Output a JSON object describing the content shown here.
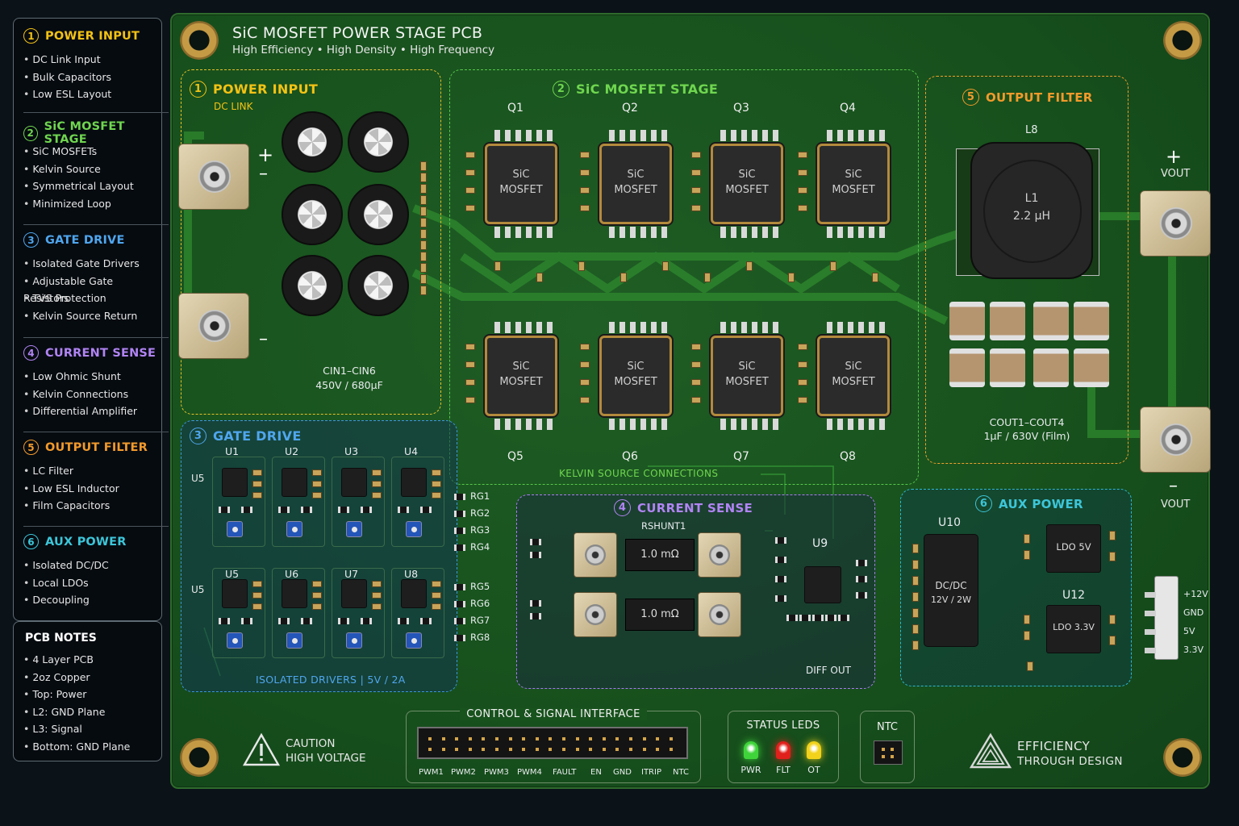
{
  "title": "SiC MOSFET POWER STAGE PCB",
  "subtitle": "High Efficiency • High Density • High Frequency",
  "colors": {
    "yellow": "#f3c214",
    "green": "#6fd64f",
    "blue": "#4fa6ee",
    "purple": "#b184f5",
    "orange": "#f39a2b",
    "cyan": "#3cc6d9",
    "board": "#1a5420"
  },
  "sidebar": [
    {
      "num": "1",
      "title": "POWER INPUT",
      "items": [
        "DC Link Input",
        "Bulk Capacitors",
        "Low ESL Layout"
      ]
    },
    {
      "num": "2",
      "title": "SiC MOSFET STAGE",
      "items": [
        "SiC MOSFETs",
        "Kelvin Source",
        "Symmetrical Layout",
        "Minimized Loop"
      ]
    },
    {
      "num": "3",
      "title": "GATE DRIVE",
      "items": [
        "Isolated Gate Drivers",
        "Adjustable Gate Resistors",
        "TVS Protection",
        "Kelvin Source Return"
      ]
    },
    {
      "num": "4",
      "title": "CURRENT SENSE",
      "items": [
        "Low Ohmic Shunt",
        "Kelvin Connections",
        "Differential Amplifier"
      ]
    },
    {
      "num": "5",
      "title": "OUTPUT FILTER",
      "items": [
        "LC Filter",
        "Low ESL Inductor",
        "Film Capacitors"
      ]
    },
    {
      "num": "6",
      "title": "AUX POWER",
      "items": [
        "Isolated DC/DC",
        "Local LDOs",
        "Decoupling"
      ]
    }
  ],
  "notes": {
    "title": "PCB NOTES",
    "items": [
      "4 Layer PCB",
      "2oz Copper",
      "Top: Power",
      "L2: GND Plane",
      "L3: Signal",
      "Bottom: GND Plane"
    ]
  },
  "zones": {
    "power_input": {
      "num": "1",
      "title": "POWER INPUT",
      "sub": "DC LINK",
      "cap_ref": "CIN1–CIN6",
      "cap_val": "450V / 680µF",
      "plus": "+",
      "minus": "–"
    },
    "mosfet": {
      "num": "2",
      "title": "SiC  MOSFET STAGE",
      "top_labels": [
        "Q1",
        "Q2",
        "Q3",
        "Q4"
      ],
      "bottom_labels": [
        "Q5",
        "Q6",
        "Q7",
        "Q8"
      ],
      "chip_line1": "SiC",
      "chip_line2": "MOSFET",
      "kelvin": "KELVIN SOURCE CONNECTIONS"
    },
    "output": {
      "num": "5",
      "title": "OUTPUT FILTER",
      "inductor_ref_top": "L8",
      "inductor_ref": "L1",
      "inductor_val": "2.2 µH",
      "cap_ref": "COUT1–COUT4",
      "cap_val": "1µF / 630V (Film)",
      "vout_plus": "+",
      "vout_minus": "–",
      "vout_label": "VOUT"
    },
    "gate": {
      "num": "3",
      "title": "GATE DRIVE",
      "top_ics": [
        "U1",
        "U2",
        "U3",
        "U4"
      ],
      "bottom_ics": [
        "U5",
        "U6",
        "U7",
        "U8"
      ],
      "side_label": "U5",
      "rg_top": [
        "RG1",
        "RG2",
        "RG3",
        "RG4"
      ],
      "rg_bottom": [
        "RG5",
        "RG6",
        "RG7",
        "RG8"
      ],
      "footer": "ISOLATED DRIVERS  |  5V / 2A"
    },
    "current": {
      "num": "4",
      "title": "CURRENT SENSE",
      "shunt_ref": "RSHUNT1",
      "shunt_val": "1.0 mΩ",
      "amp_ref": "U9",
      "amp_out": "DIFF OUT"
    },
    "aux": {
      "num": "6",
      "title": "AUX POWER",
      "dcdc_ref": "U10",
      "dcdc_l1": "DC/DC",
      "dcdc_l2": "12V / 2W",
      "ldo1": "LDO 5V",
      "ldo2_ref": "U12",
      "ldo2": "LDO 3.3V",
      "conn": [
        "+12V",
        "GND",
        "5V",
        "3.3V"
      ]
    }
  },
  "control": {
    "title": "CONTROL & SIGNAL INTERFACE",
    "pins": [
      "PWM1",
      "PWM2",
      "PWM3",
      "PWM4",
      "FAULT",
      "EN",
      "GND",
      "ITRIP",
      "NTC"
    ]
  },
  "status": {
    "title": "STATUS LEDS",
    "leds": [
      {
        "label": "PWR",
        "color": "#3fd43a"
      },
      {
        "label": "FLT",
        "color": "#e0201b"
      },
      {
        "label": "OT",
        "color": "#f2d21a"
      }
    ]
  },
  "ntc": {
    "title": "NTC"
  },
  "caution": {
    "line1": "CAUTION",
    "line2": "HIGH VOLTAGE"
  },
  "efficiency": {
    "line1": "EFFICIENCY",
    "line2": "THROUGH DESIGN"
  }
}
